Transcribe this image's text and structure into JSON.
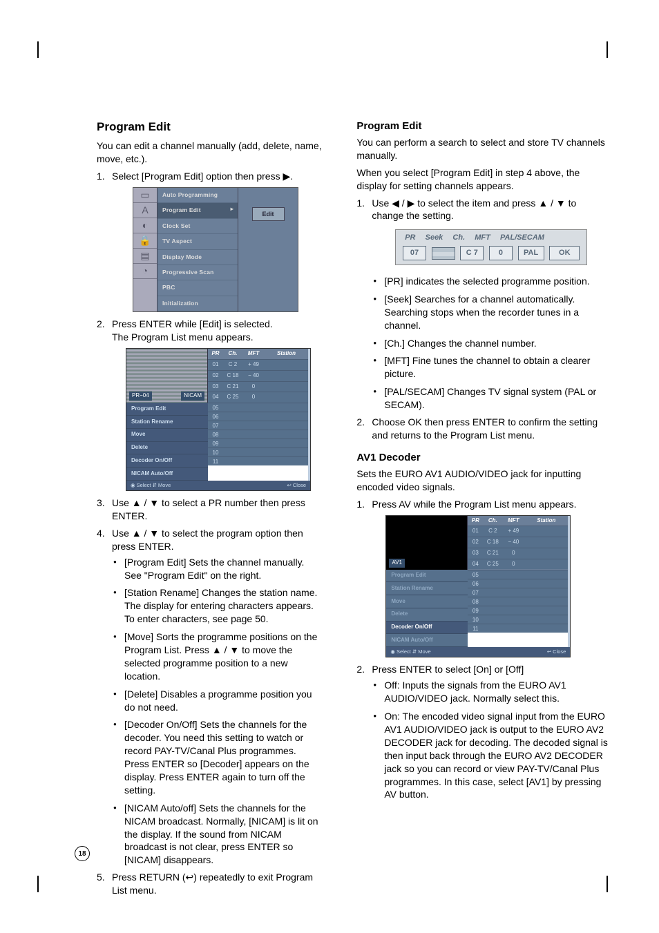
{
  "left": {
    "h2": "Program Edit",
    "intro": "You can edit a channel manually (add, delete, name, move, etc.).",
    "step1": "Select [Program Edit] option then press ▶.",
    "menu1_items": [
      "Auto Programming",
      "Program Edit",
      "Clock Set",
      "TV Aspect",
      "Display Mode",
      "Progressive Scan",
      "PBC",
      "Initialization"
    ],
    "menu1_edit": "Edit",
    "step2a": "Press ENTER while [Edit] is selected.",
    "step2b": "The Program List menu appears.",
    "plist_hdr": [
      "PR",
      "Ch.",
      "MFT",
      "Station"
    ],
    "plist_rows_top": [
      [
        "01",
        "C 2",
        "+ 49",
        ""
      ],
      [
        "02",
        "C 18",
        "− 40",
        ""
      ],
      [
        "03",
        "C 21",
        "0",
        ""
      ],
      [
        "04",
        "C 25",
        "0",
        ""
      ]
    ],
    "plist_badge1": "PR−04",
    "plist_badge2": "NICAM",
    "plist_opts": [
      "Program Edit",
      "Station Rename",
      "Move",
      "Delete",
      "Decoder On/Off",
      "NICAM Auto/Off"
    ],
    "plist_rows_bot": [
      "05",
      "06",
      "07",
      "08",
      "09",
      "10",
      "11"
    ],
    "plist_foot_l": "◉ Select  ⇵ Move",
    "plist_foot_r": "↩ Close",
    "step3": "Use ▲ / ▼ to select a PR number then press ENTER.",
    "step4": "Use ▲ / ▼ to select the program option then press ENTER.",
    "opts": [
      "[Program Edit] Sets the channel manually. See \"Program Edit\" on the right.",
      "[Station Rename] Changes the station name. The display for entering characters appears. To enter characters, see page 50.",
      "[Move] Sorts the programme positions on the Program List. Press ▲ / ▼ to move the selected programme position to a new location.",
      "[Delete] Disables a programme position you do not need.",
      "[Decoder On/Off] Sets the channels for the decoder. You need this setting to watch or record PAY-TV/Canal Plus programmes. Press ENTER so [Decoder] appears on the display. Press ENTER again to turn off the setting.",
      "[NICAM Auto/off] Sets the channels for the NICAM broadcast. Normally, [NICAM] is lit on the display. If the sound from NICAM broadcast is not clear, press ENTER so [NICAM] disappears."
    ],
    "step5": "Press RETURN (↩) repeatedly to exit Program List menu."
  },
  "right": {
    "h3a": "Program Edit",
    "p1": "You can perform a search to select and store TV channels manually.",
    "p2": "When you select [Program Edit] in step 4 above, the display for setting channels appears.",
    "step1": "Use ◀ / ▶ to select the item and press ▲ / ▼ to change the setting.",
    "tune_hdr": [
      "PR",
      "Seek",
      "Ch.",
      "MFT",
      "PAL/SECAM"
    ],
    "tune_row": [
      "07",
      "",
      "C 7",
      "0",
      "PAL",
      "OK"
    ],
    "bullets1": [
      "[PR] indicates the selected programme position.",
      "[Seek] Searches for a channel automatically. Searching stops when the recorder tunes in a channel.",
      "[Ch.] Changes the channel number.",
      "[MFT] Fine tunes the channel to obtain a clearer picture.",
      "[PAL/SECAM] Changes TV signal system (PAL or SECAM)."
    ],
    "step2": "Choose OK then press ENTER to confirm the setting and returns to the Program List menu.",
    "h3b": "AV1 Decoder",
    "p3": "Sets the EURO AV1 AUDIO/VIDEO jack for inputting encoded video signals.",
    "stepB1": "Press AV while the Program List menu appears.",
    "av_badge": "AV1",
    "av_opts": [
      "Program Edit",
      "Station Rename",
      "Move",
      "Delete",
      "Decoder On/Off",
      "NICAM Auto/Off"
    ],
    "stepB2": "Press ENTER to select [On] or [Off]",
    "bullets2": [
      "Off: Inputs the signals from the EURO AV1 AUDIO/VIDEO jack. Normally select this.",
      "On: The encoded video signal input from the EURO AV1 AUDIO/VIDEO jack is output to the EURO AV2 DECODER jack for decoding. The decoded signal is then input back through the EURO AV2 DECODER jack so you can record or view PAY-TV/Canal Plus programmes. In this case, select [AV1] by pressing AV button."
    ]
  },
  "page_number": "18"
}
